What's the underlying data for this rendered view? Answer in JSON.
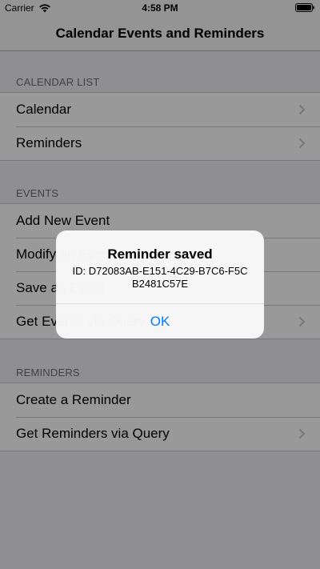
{
  "status_bar": {
    "carrier": "Carrier",
    "time": "4:58 PM"
  },
  "nav": {
    "title": "Calendar Events and Reminders"
  },
  "sections": {
    "calendar_list": {
      "header": "CALENDAR LIST",
      "rows": [
        "Calendar",
        "Reminders"
      ]
    },
    "events": {
      "header": "EVENTS",
      "rows": [
        "Add New Event",
        "Modify an Event",
        "Save an Event",
        "Get Events via Query"
      ]
    },
    "reminders": {
      "header": "REMINDERS",
      "rows": [
        "Create a Reminder",
        "Get Reminders via Query"
      ]
    }
  },
  "alert": {
    "title": "Reminder saved",
    "message": "ID: D72083AB-E151-4C29-B7C6-F5CB2481C57E",
    "ok_label": "OK"
  },
  "colors": {
    "accent": "#007aff",
    "background": "#efeff4",
    "section_header": "#6d6d72"
  }
}
